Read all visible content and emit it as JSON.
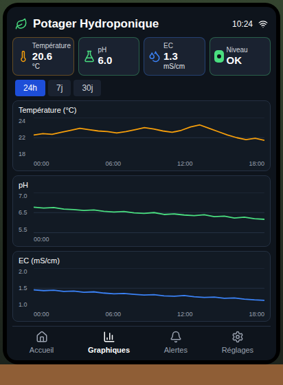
{
  "header": {
    "title": "Potager Hydroponique",
    "time": "10:24"
  },
  "cards": [
    {
      "kind": "temperature",
      "label": "Température",
      "value": "20.6",
      "unit": "°C",
      "color": "#f59e0b"
    },
    {
      "kind": "ph",
      "label": "pH",
      "value": "6.0",
      "unit": "",
      "color": "#4ade80"
    },
    {
      "kind": "ec",
      "label": "EC",
      "value": "1.3",
      "unit": "mS/cm",
      "color": "#3b82f6"
    },
    {
      "kind": "level",
      "label": "Niveau",
      "value": "OK",
      "unit": "",
      "color": "#4ade80"
    }
  ],
  "ranges": [
    {
      "label": "24h",
      "selected": true
    },
    {
      "label": "7j",
      "selected": false
    },
    {
      "label": "30j",
      "selected": false
    }
  ],
  "charts": [
    {
      "title": "Température (°C)",
      "color": "#f59e0b",
      "y_ticks": [
        "24",
        "22",
        "18"
      ],
      "x_ticks": [
        "00:00",
        "06:00",
        "12:00",
        "18:00"
      ],
      "values": [
        21.4,
        21.6,
        21.5,
        21.8,
        22.1,
        22.4,
        22.2,
        22.0,
        21.9,
        21.7,
        21.9,
        22.2,
        22.5,
        22.3,
        22.0,
        21.8,
        22.1,
        22.6,
        22.9,
        22.4,
        21.9,
        21.4,
        21.0,
        20.7,
        20.9,
        20.6
      ]
    },
    {
      "title": "pH",
      "color": "#4ade80",
      "y_ticks": [
        "7.0",
        "6.5",
        "5.5"
      ],
      "x_ticks": [
        "00:00"
      ],
      "values": [
        6.45,
        6.42,
        6.44,
        6.38,
        6.36,
        6.33,
        6.35,
        6.3,
        6.27,
        6.29,
        6.24,
        6.22,
        6.25,
        6.18,
        6.2,
        6.16,
        6.14,
        6.17,
        6.1,
        6.12,
        6.05,
        6.08,
        6.02,
        6.0
      ]
    },
    {
      "title": "EC (mS/cm)",
      "color": "#3b82f6",
      "y_ticks": [
        "2.0",
        "1.5",
        "1.0"
      ],
      "x_ticks": [
        "00:00",
        "06:00",
        "12:00",
        "18:00"
      ],
      "values": [
        1.46,
        1.44,
        1.45,
        1.42,
        1.43,
        1.4,
        1.41,
        1.38,
        1.36,
        1.37,
        1.35,
        1.33,
        1.34,
        1.31,
        1.3,
        1.32,
        1.29,
        1.27,
        1.28,
        1.25,
        1.26,
        1.23,
        1.21,
        1.2
      ]
    }
  ],
  "nav": [
    {
      "kind": "home",
      "label": "Accueil",
      "selected": false
    },
    {
      "kind": "charts",
      "label": "Graphiques",
      "selected": true
    },
    {
      "kind": "alerts",
      "label": "Alertes",
      "selected": false
    },
    {
      "kind": "settings",
      "label": "Réglages",
      "selected": false
    }
  ]
}
